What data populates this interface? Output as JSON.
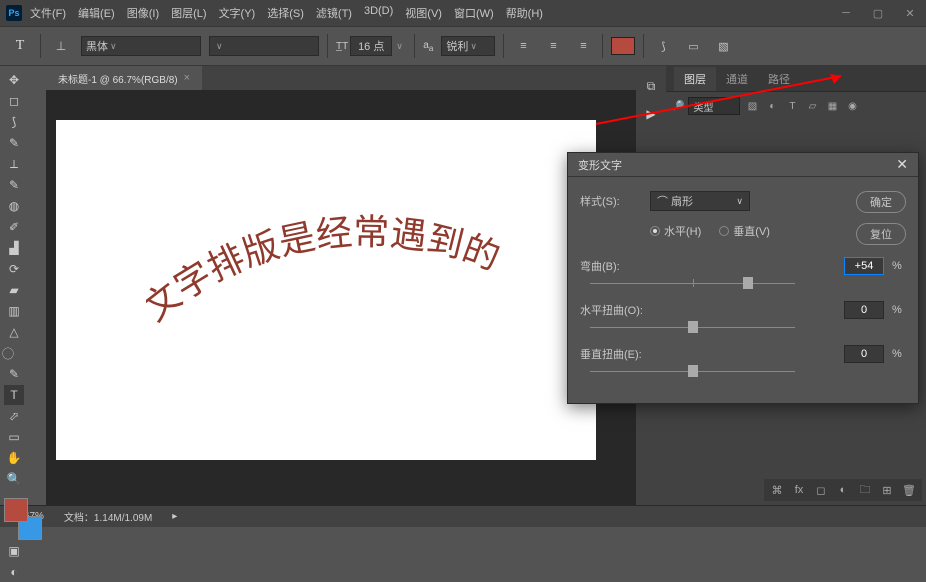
{
  "menu": [
    "文件(F)",
    "编辑(E)",
    "图像(I)",
    "图层(L)",
    "文字(Y)",
    "选择(S)",
    "滤镜(T)",
    "3D(D)",
    "视图(V)",
    "窗口(W)",
    "帮助(H)"
  ],
  "optbar": {
    "font_family": "黑体",
    "font_style": "",
    "size_label": "16 点",
    "aa": "锐利"
  },
  "doc_tab": {
    "label": "未标题-1 @ 66.7%(RGB/8)"
  },
  "canvas_text": "文字排版是经常遇到的",
  "panels": {
    "tabs": [
      "图层",
      "通道",
      "路径"
    ],
    "kind": "类型"
  },
  "dialog": {
    "title": "变形文字",
    "style_label": "样式(S):",
    "style_value": "⌒ 扇形",
    "horiz": "水平(H)",
    "vert": "垂直(V)",
    "bend_label": "弯曲(B):",
    "bend_value": "+54",
    "hdist_label": "水平扭曲(O):",
    "hdist_value": "0",
    "vdist_label": "垂直扭曲(E):",
    "vdist_value": "0",
    "pct": "%",
    "ok": "确定",
    "reset": "复位"
  },
  "status": {
    "zoom": "66.67%",
    "doc": "文档：1.14M/1.09M"
  },
  "colors": {
    "fg": "#b54a3e",
    "bg": "#3799e5",
    "text_color": "#903a2e"
  }
}
